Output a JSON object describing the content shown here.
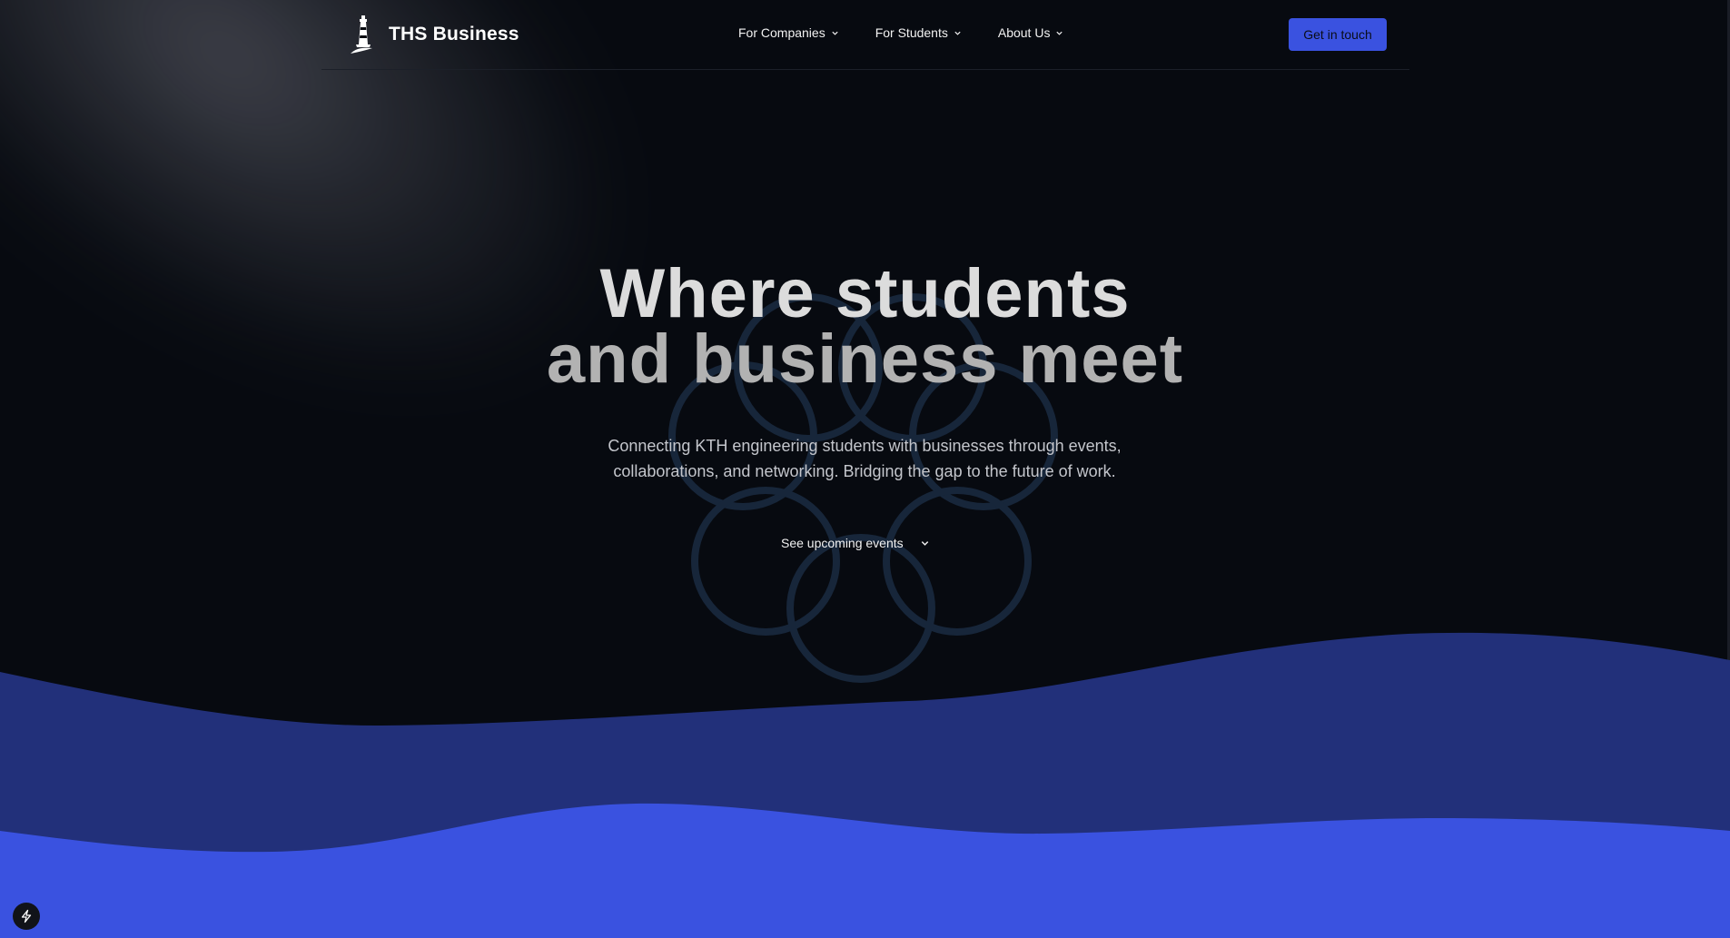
{
  "brand": {
    "name": "THS Business",
    "logo_icon": "lighthouse-icon"
  },
  "nav": {
    "items": [
      {
        "label": "For Companies",
        "icon": "chevron-down-icon"
      },
      {
        "label": "For Students",
        "icon": "chevron-down-icon"
      },
      {
        "label": "About Us",
        "icon": "chevron-down-icon"
      }
    ],
    "cta_label": "Get in touch"
  },
  "hero": {
    "title_line1": "Where students",
    "title_line2": "and business meet",
    "subtitle": "Connecting KTH engineering students with businesses through events, collaborations, and networking. Bridging the gap to the future of work.",
    "events_link_label": "See upcoming events",
    "events_link_icon": "chevron-down-icon"
  },
  "floating_button": {
    "icon": "lightning-icon"
  },
  "colors": {
    "background": "#070a10",
    "accent": "#3a52e0",
    "wave_dark": "#22307a",
    "wave_bright": "#3a52e0",
    "ring": "#17263a"
  }
}
